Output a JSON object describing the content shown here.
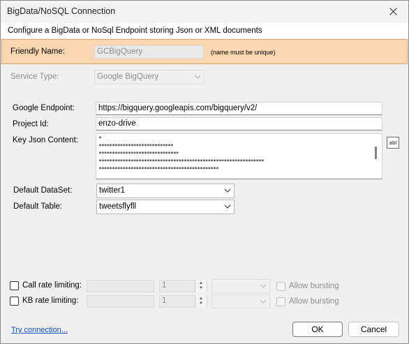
{
  "window": {
    "title": "BigData/NoSQL Connection",
    "header": "Configure a BigData or NoSql Endpoint storing Json or XML documents"
  },
  "friendly": {
    "label": "Friendly Name:",
    "value": "GCBigQuery",
    "hint": "(name must be unique)"
  },
  "service": {
    "label": "Service Type:",
    "value": "Google BigQuery"
  },
  "endpoint": {
    "label": "Google Endpoint:",
    "value": "https://bigquery.googleapis.com/bigquery/v2/"
  },
  "project": {
    "label": "Project Id:",
    "value": "enzo-drive"
  },
  "key_json": {
    "label": "Key Json Content:",
    "lines": [
      "*",
      "****************************",
      "******************************",
      "**************************************************************",
      "*********************************************"
    ],
    "editor_button_icon": "text-field-icon",
    "editor_button_text": "abl"
  },
  "dataset": {
    "label": "Default DataSet:",
    "value": "twitter1"
  },
  "table": {
    "label": "Default Table:",
    "value": "tweetsflyfll"
  },
  "rate_call": {
    "label": "Call rate limiting:",
    "count": "1",
    "bursting": "Allow bursting"
  },
  "rate_kb": {
    "label": "KB rate limiting:",
    "count": "1",
    "bursting": "Allow bursting"
  },
  "footer": {
    "try_link": "Try connection...",
    "ok": "OK",
    "cancel": "Cancel"
  }
}
